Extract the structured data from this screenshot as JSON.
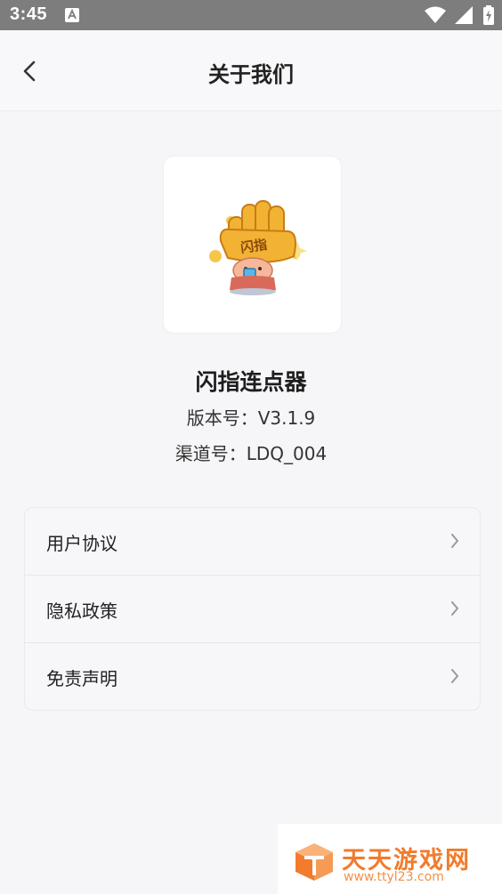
{
  "status_bar": {
    "time": "3:45"
  },
  "header": {
    "title": "关于我们",
    "back_icon": "chevron-left-icon"
  },
  "app": {
    "name": "闪指连点器",
    "version": "版本号：V3.1.9",
    "channel": "渠道号：LDQ_004",
    "logo_text": "闪指"
  },
  "menu": {
    "items": [
      {
        "label": "用户协议",
        "icon": "chevron-right-icon"
      },
      {
        "label": "隐私政策",
        "icon": "chevron-right-icon"
      },
      {
        "label": "免责声明",
        "icon": "chevron-right-icon"
      }
    ]
  },
  "watermark": {
    "title": "天天游戏网",
    "url": "www.ttyl23.com",
    "color": "#f27b2c"
  },
  "colors": {
    "status_bar": "#7d7d7d",
    "background": "#f6f6f9",
    "logo_glove": "#f2b233"
  }
}
